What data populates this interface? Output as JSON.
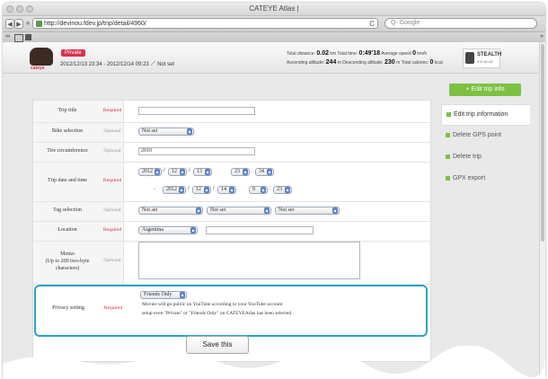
{
  "browser": {
    "window_title": "CATEYE Atlas |",
    "url": "http://devinou.fdev.jp/trip/detail/4960/",
    "search_placeholder": "Q- Google",
    "back": "◀",
    "forward": "▶",
    "add": "+",
    "reload": "C",
    "bookmarks_icon": "∞",
    "overflow": "»"
  },
  "header": {
    "brand_label": "cateye",
    "privacy_badge": "Private",
    "date_range": "2012/12/13 23:34 - 2012/12/14 09:23 ／ Not set",
    "stats": {
      "line1_total_distance_label": "Total distance:",
      "total_distance": "0.02",
      "total_distance_unit": "km",
      "total_time_label": "Total time:",
      "total_time": "0:49'18",
      "avg_speed_label": "Average speed",
      "avg_speed": "0",
      "avg_speed_unit": "km/h",
      "line2_ascending_label": "Ascending altitude:",
      "ascending": "244",
      "ascending_unit": "m",
      "descending_label": "Descending altitude:",
      "descending": "230",
      "descending_unit": "m",
      "calories_label": "Total calories:",
      "calories": "0",
      "calories_unit": "kcal"
    },
    "device_name": "STEALTH",
    "device_sub": "ICE BLUE"
  },
  "edit_button": "+ Edit trip info",
  "form": {
    "required": "Required",
    "optional": "Optional",
    "trip_title_label": "Trip title",
    "bike_label": "Bike selection",
    "bike_value": "Not set",
    "tire_label": "Tire circumference",
    "tire_value": "2010",
    "date_label": "Trip date and time",
    "start": {
      "year": "2012",
      "month": "12",
      "day": "13",
      "hour": "23",
      "minute": "34"
    },
    "end": {
      "year": "2012",
      "month": "12",
      "day": "14",
      "hour": "9",
      "minute": "23"
    },
    "tag_label": "Tag selection",
    "tags": [
      "Not set",
      "Not set",
      "Not set"
    ],
    "location_label": "Location",
    "location_value": "Argentina",
    "memo_label_1": "Memo",
    "memo_label_2": "(Up to 200 two-byte",
    "memo_label_3": "characters)",
    "privacy_label": "Privacy setting",
    "privacy_value": "Friends Only",
    "privacy_note_1": "Movies will go public on YouTube according to your YouTube account",
    "privacy_note_2": "setup even \"Private\" or \"Friends Only\" on CATEYEAtlas has been selected.",
    "save_label": "Save this"
  },
  "sidebar": {
    "items": [
      {
        "label": "Edit trip information"
      },
      {
        "label": "Delete GPS point"
      },
      {
        "label": "Delete trip"
      },
      {
        "label": "GPX export"
      }
    ]
  }
}
